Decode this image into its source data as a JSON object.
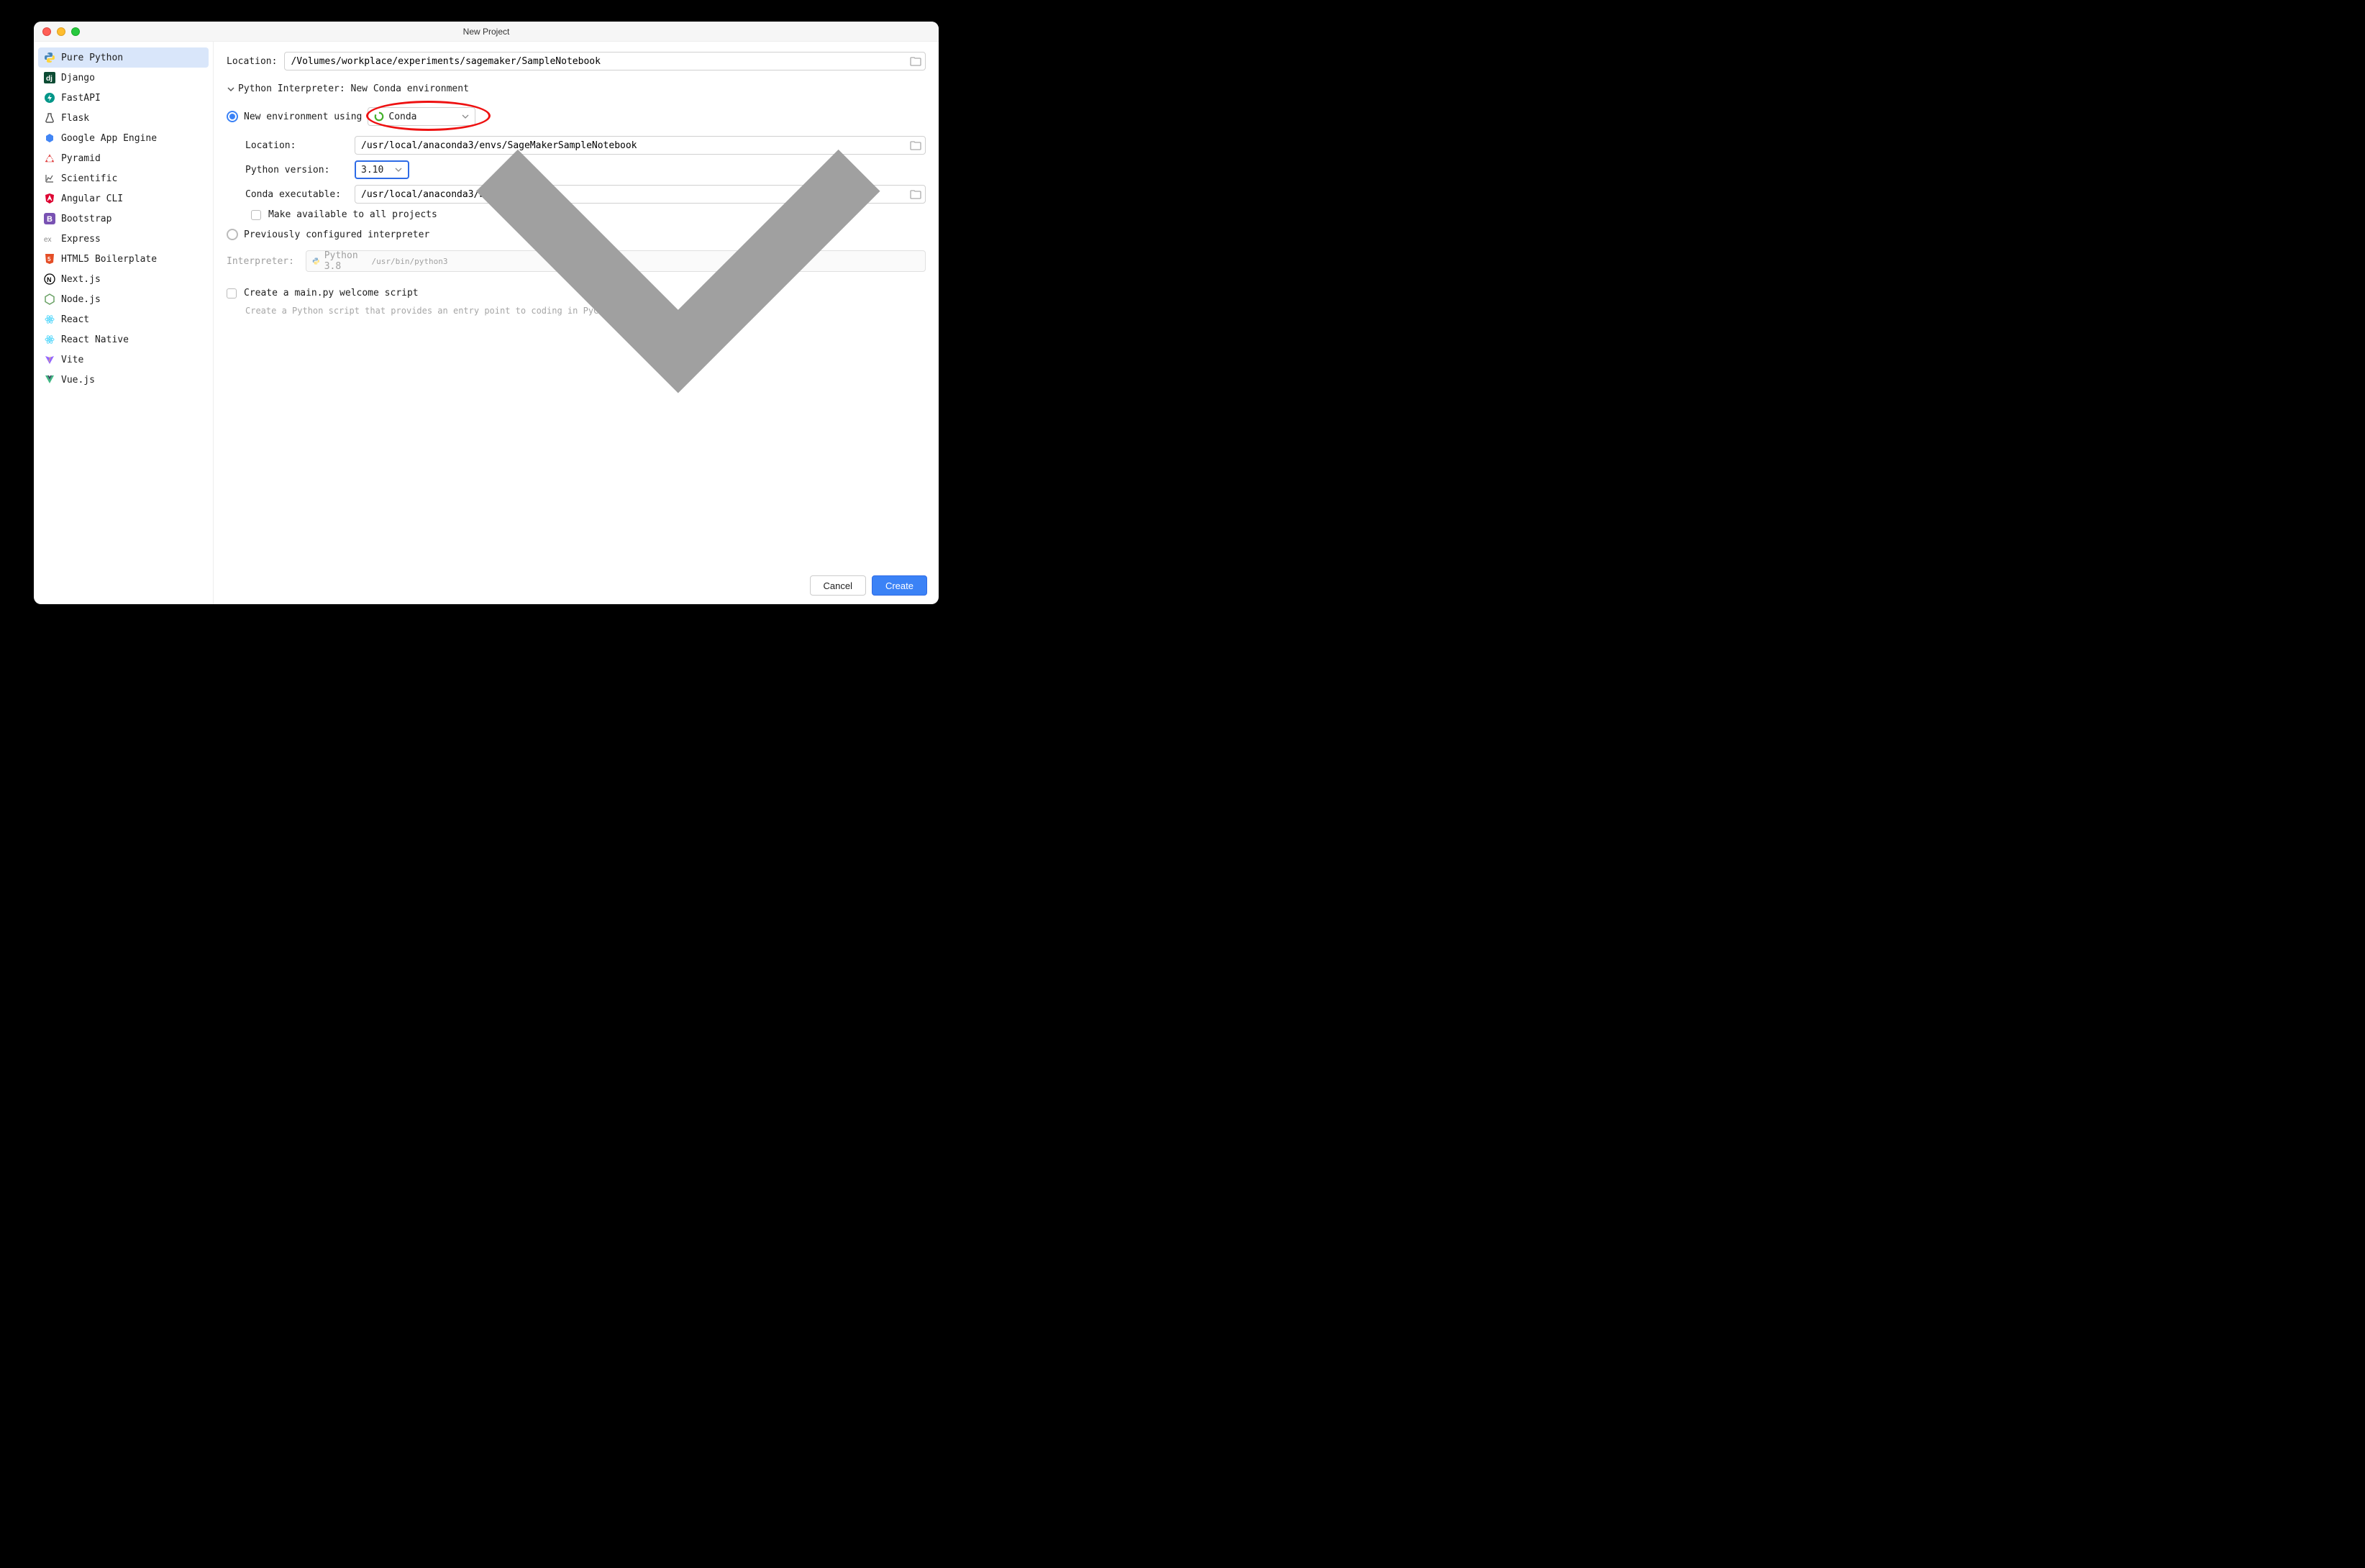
{
  "window": {
    "title": "New Project"
  },
  "sidebar": {
    "items": [
      {
        "label": "Pure Python"
      },
      {
        "label": "Django"
      },
      {
        "label": "FastAPI"
      },
      {
        "label": "Flask"
      },
      {
        "label": "Google App Engine"
      },
      {
        "label": "Pyramid"
      },
      {
        "label": "Scientific"
      },
      {
        "label": "Angular CLI"
      },
      {
        "label": "Bootstrap"
      },
      {
        "label": "Express"
      },
      {
        "label": "HTML5 Boilerplate"
      },
      {
        "label": "Next.js"
      },
      {
        "label": "Node.js"
      },
      {
        "label": "React"
      },
      {
        "label": "React Native"
      },
      {
        "label": "Vite"
      },
      {
        "label": "Vue.js"
      }
    ]
  },
  "form": {
    "location_label": "Location:",
    "location_value": "/Volumes/workplace/experiments/sagemaker/SampleNotebook",
    "interpreter_header": "Python Interpreter: New Conda environment",
    "new_env_label": "New environment using",
    "env_tool": "Conda",
    "env_location_label": "Location:",
    "env_location_value": "/usr/local/anaconda3/envs/SageMakerSampleNotebook",
    "py_version_label": "Python version:",
    "py_version_value": "3.10",
    "conda_exe_label": "Conda executable:",
    "conda_exe_value": "/usr/local/anaconda3/bin/conda",
    "make_available_label": "Make available to all projects",
    "previous_label": "Previously configured interpreter",
    "interp_label": "Interpreter:",
    "interp_name": "Python 3.8",
    "interp_path": "/usr/bin/python3",
    "create_main_label": "Create a main.py welcome script",
    "create_main_hint": "Create a Python script that provides an entry point to coding in PyCharm."
  },
  "buttons": {
    "cancel": "Cancel",
    "create": "Create"
  }
}
